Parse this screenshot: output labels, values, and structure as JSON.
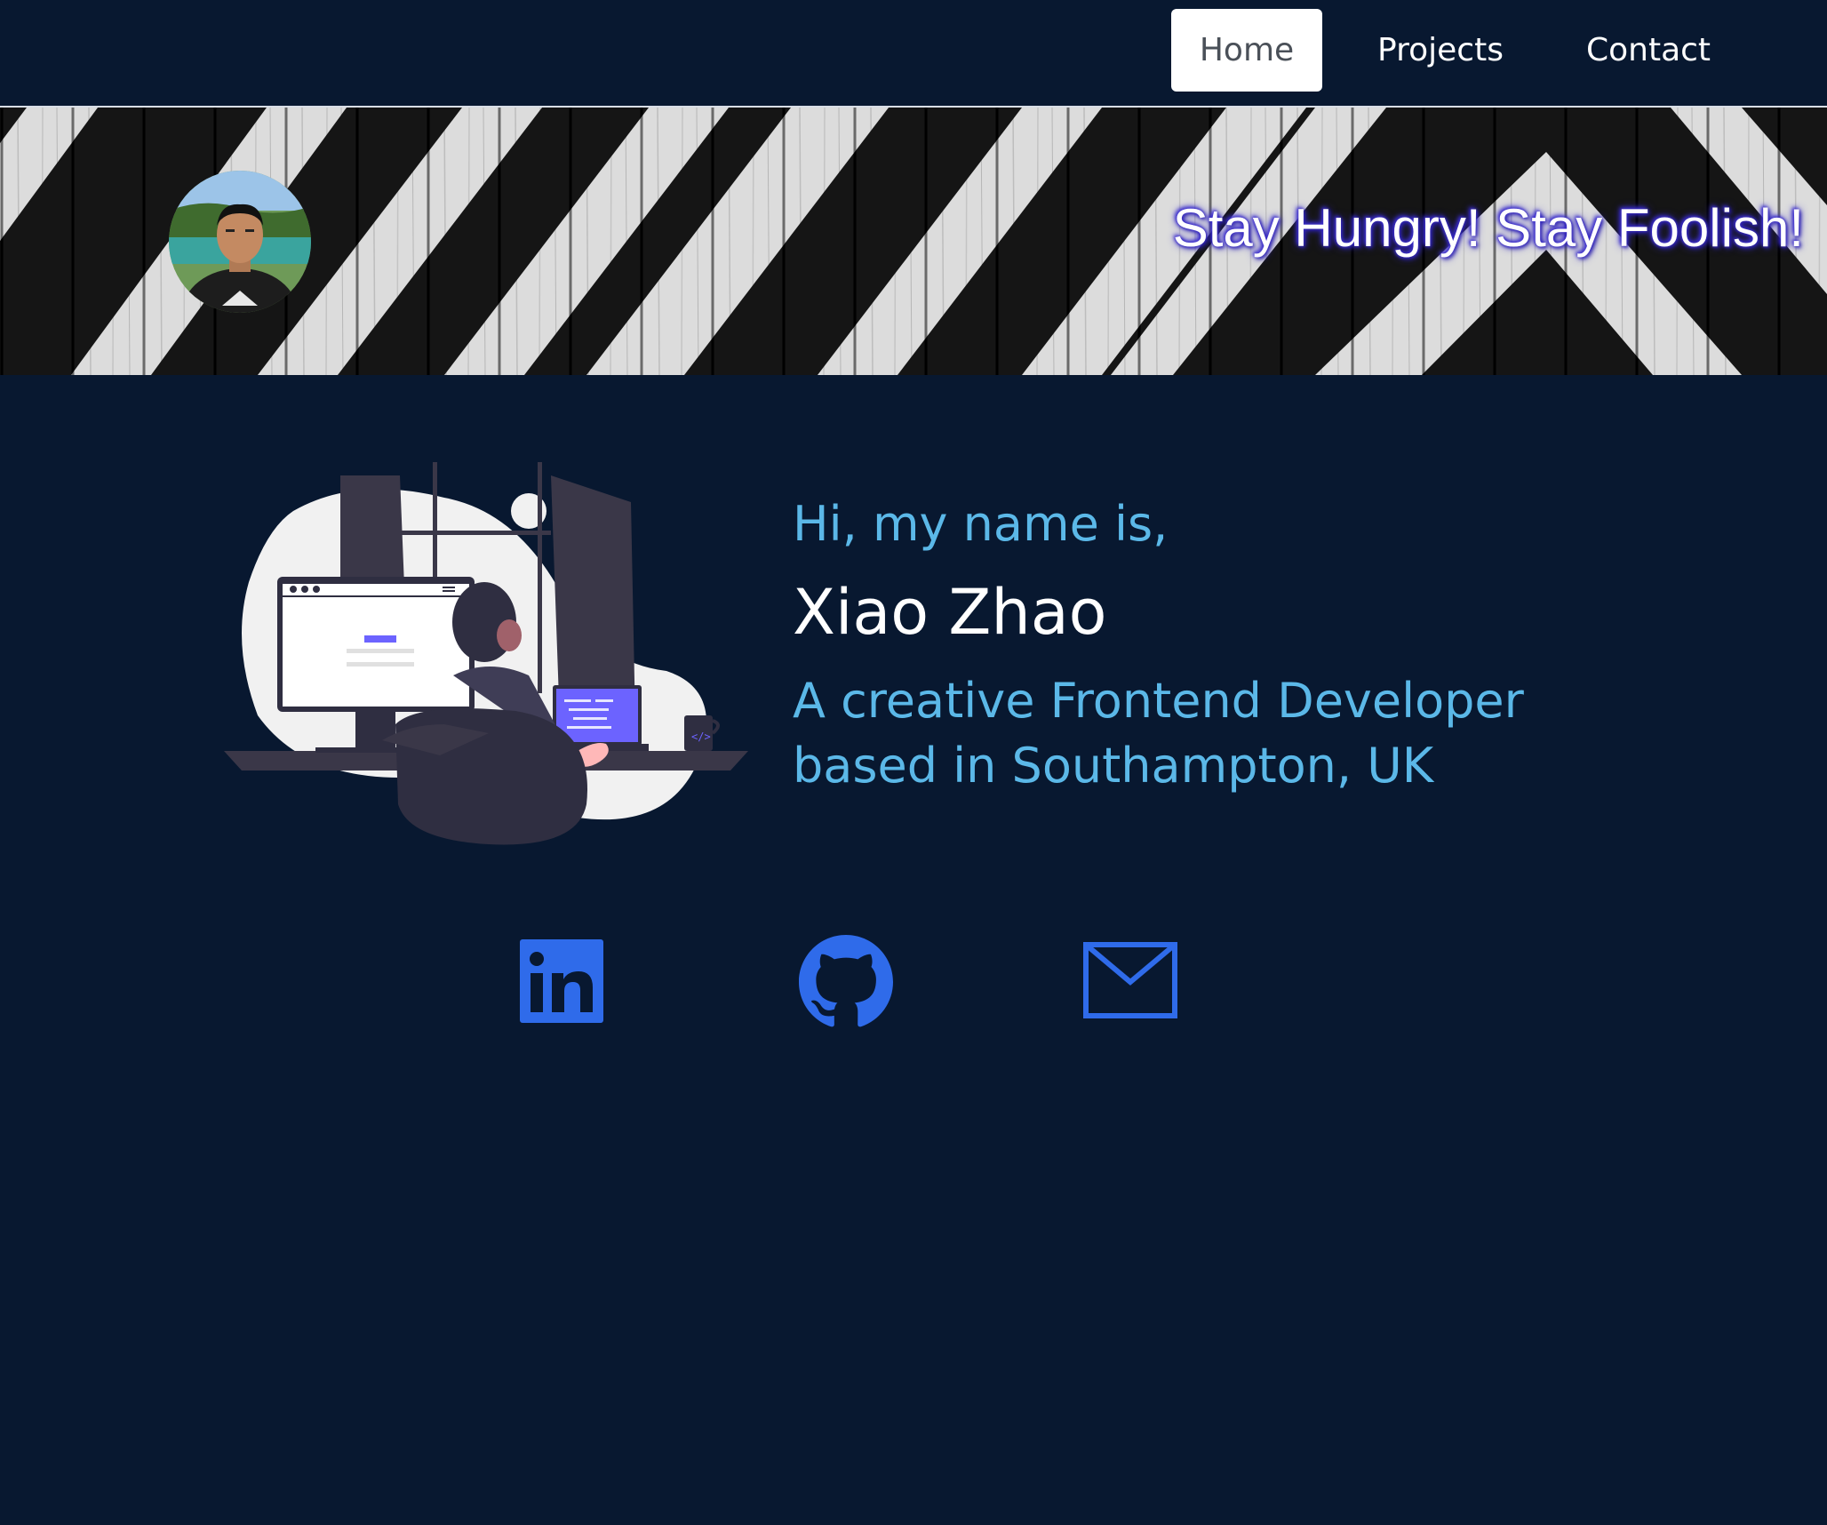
{
  "nav": {
    "items": [
      {
        "label": "Home",
        "active": true
      },
      {
        "label": "Projects",
        "active": false
      },
      {
        "label": "Contact",
        "active": false
      }
    ]
  },
  "banner": {
    "slogan": "Stay Hungry! Stay Foolish!",
    "avatar_icon": "profile-photo"
  },
  "hero": {
    "greeting": "Hi, my name is,",
    "name": "Xiao Zhao",
    "tagline": "A creative Frontend Developer based in Southampton, UK"
  },
  "social": [
    {
      "icon": "linkedin-icon"
    },
    {
      "icon": "github-icon"
    },
    {
      "icon": "mail-icon"
    }
  ],
  "colors": {
    "background": "#081830",
    "accent": "#5bb8e8",
    "icon_blue": "#2f6bea",
    "slogan_glow": "#3d2fd0"
  }
}
